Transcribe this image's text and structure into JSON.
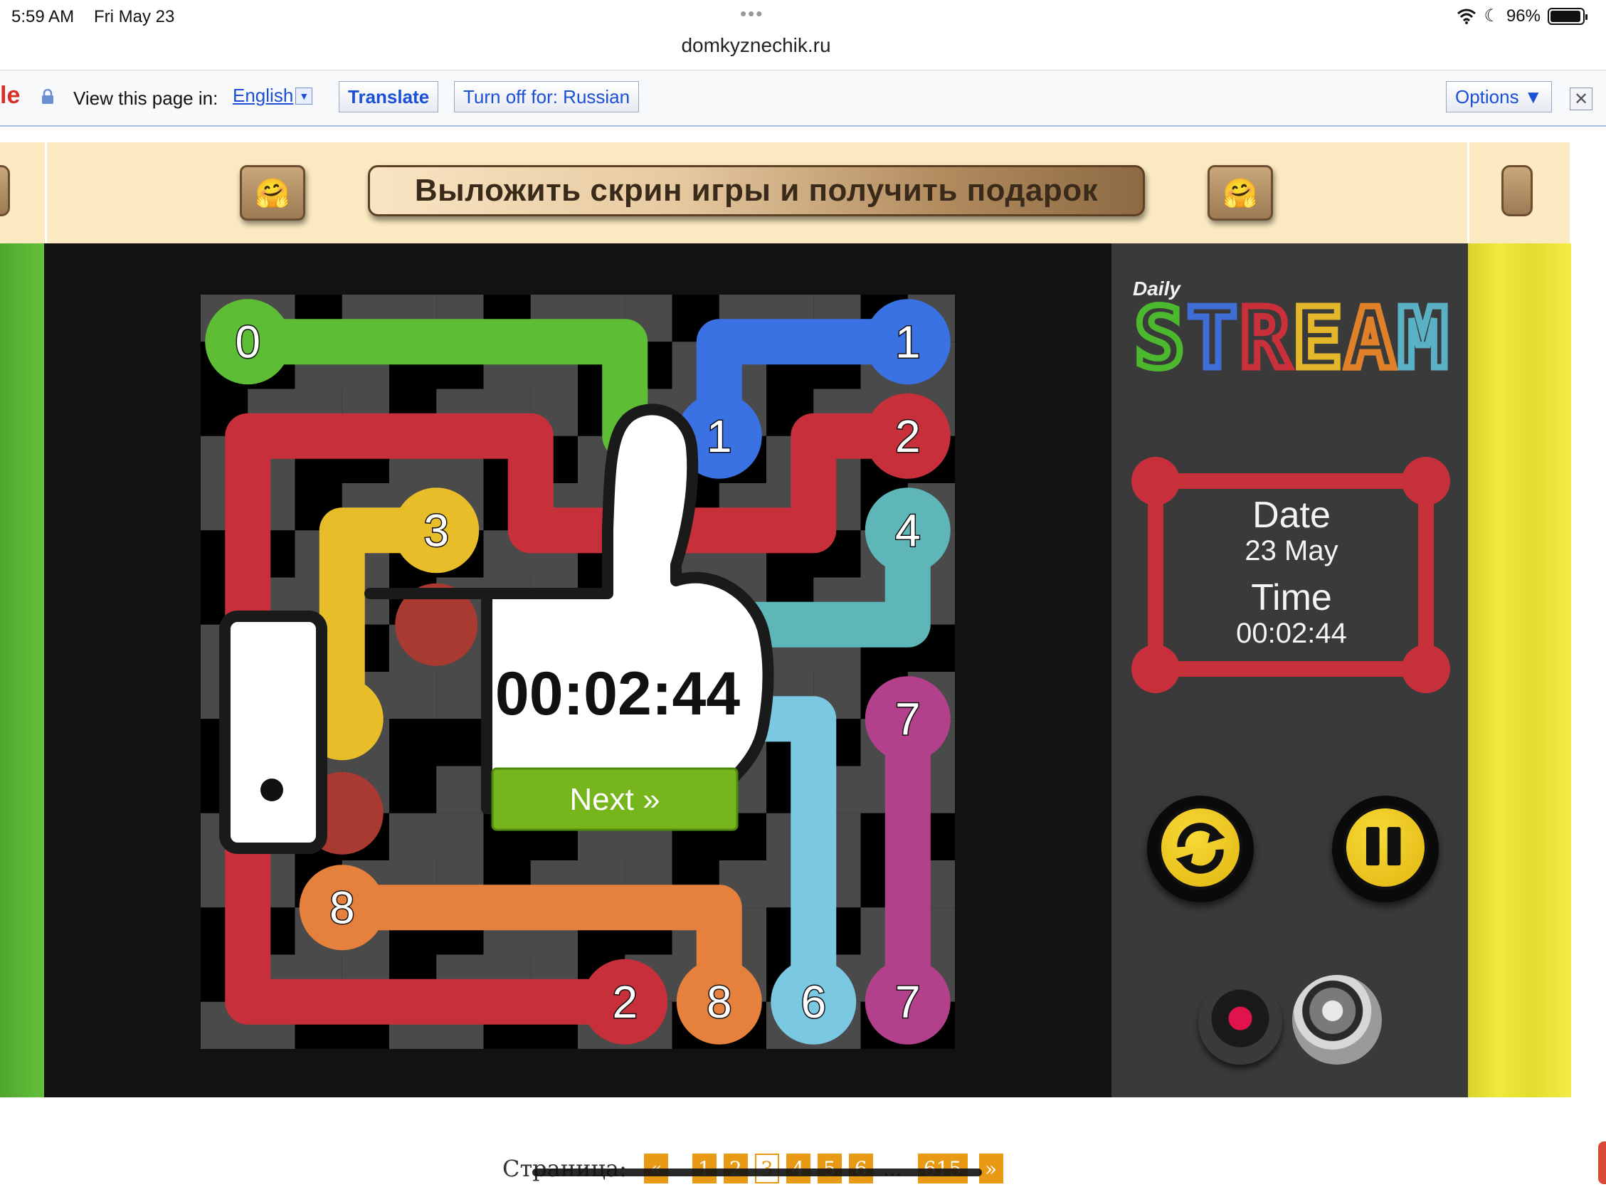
{
  "status_bar": {
    "time": "5:59 AM",
    "date": "Fri May 23",
    "battery": "96%",
    "battery_level": 0.96,
    "url": "domkyznechik.ru"
  },
  "translate_bar": {
    "view_label": "View this page in:",
    "language": "English",
    "translate_label": "Translate",
    "turn_off_label": "Turn off for: Russian",
    "options_label": "Options ▼",
    "close_glyph": "✕"
  },
  "banner": {
    "cta": "Выложить скрин игры и получить подарок",
    "emoji": "🤗"
  },
  "game": {
    "logo_daily": "Daily",
    "logo_stream": "STREAM",
    "logo_letter_colors": [
      "#4cb82d",
      "#3f6fd6",
      "#c9303a",
      "#e4b62a",
      "#e0812a",
      "#5ab0c4"
    ],
    "date_label": "Date",
    "date_value": "23 May",
    "time_label": "Time",
    "time_value": "00:02:44",
    "overlay_time": "00:02:44",
    "next_label": "Next »",
    "grid_size": 8,
    "colors": {
      "0": "#5dbe36",
      "1": "#3a72e3",
      "2": "#c7303b",
      "3": "#e8bd2a",
      "4": "#5fb6b9",
      "6": "#7ac8e1",
      "7": "#b2408a",
      "8": "#e5803d",
      "5": "#a83a32"
    },
    "endpoints": [
      {
        "num": "0",
        "color": "0",
        "r": 0,
        "c": 0
      },
      {
        "num": "1",
        "color": "1",
        "r": 0,
        "c": 7
      },
      {
        "num": "1",
        "color": "1",
        "r": 1,
        "c": 5
      },
      {
        "num": "2",
        "color": "2",
        "r": 1,
        "c": 7
      },
      {
        "num": "3",
        "color": "3",
        "r": 2,
        "c": 2
      },
      {
        "num": "4",
        "color": "4",
        "r": 2,
        "c": 7
      },
      {
        "num": "7",
        "color": "7",
        "r": 4,
        "c": 7
      },
      {
        "num": "8",
        "color": "8",
        "r": 6,
        "c": 1
      },
      {
        "num": "2",
        "color": "2",
        "r": 7,
        "c": 4
      },
      {
        "num": "8",
        "color": "8",
        "r": 7,
        "c": 5
      },
      {
        "num": "6",
        "color": "6",
        "r": 7,
        "c": 6
      },
      {
        "num": "7",
        "color": "7",
        "r": 7,
        "c": 7
      }
    ],
    "paths": [
      {
        "color": "0",
        "cells": [
          [
            0,
            0
          ],
          [
            0,
            4
          ],
          [
            1,
            4
          ]
        ]
      },
      {
        "color": "1",
        "cells": [
          [
            0,
            7
          ],
          [
            0,
            5
          ],
          [
            1,
            5
          ]
        ]
      },
      {
        "color": "2",
        "cells": [
          [
            1,
            7
          ],
          [
            1,
            6
          ],
          [
            2,
            6
          ],
          [
            2,
            3
          ],
          [
            1,
            3
          ],
          [
            1,
            0
          ],
          [
            7,
            0
          ],
          [
            7,
            4
          ]
        ]
      },
      {
        "color": "3",
        "cells": [
          [
            2,
            2
          ],
          [
            2,
            1
          ],
          [
            4,
            1
          ]
        ]
      },
      {
        "color": "4",
        "cells": [
          [
            2,
            7
          ],
          [
            3,
            7
          ],
          [
            3,
            5
          ]
        ]
      },
      {
        "color": "6",
        "cells": [
          [
            7,
            6
          ],
          [
            4,
            6
          ],
          [
            4,
            5
          ]
        ]
      },
      {
        "color": "7",
        "cells": [
          [
            4,
            7
          ],
          [
            7,
            7
          ]
        ]
      },
      {
        "color": "8",
        "cells": [
          [
            6,
            1
          ],
          [
            6,
            5
          ],
          [
            7,
            5
          ]
        ]
      }
    ],
    "hidden_blobs": [
      {
        "color": "5",
        "r": 3,
        "c": 2
      },
      {
        "color": "3",
        "r": 4,
        "c": 1
      },
      {
        "color": "5",
        "r": 5,
        "c": 1
      }
    ]
  },
  "pagination": {
    "label": "Страница:",
    "prev": "«",
    "pages": [
      "1",
      "2",
      "3",
      "4",
      "5",
      "6"
    ],
    "current": "3",
    "ellipsis": "...",
    "last": "615",
    "next": "»"
  }
}
